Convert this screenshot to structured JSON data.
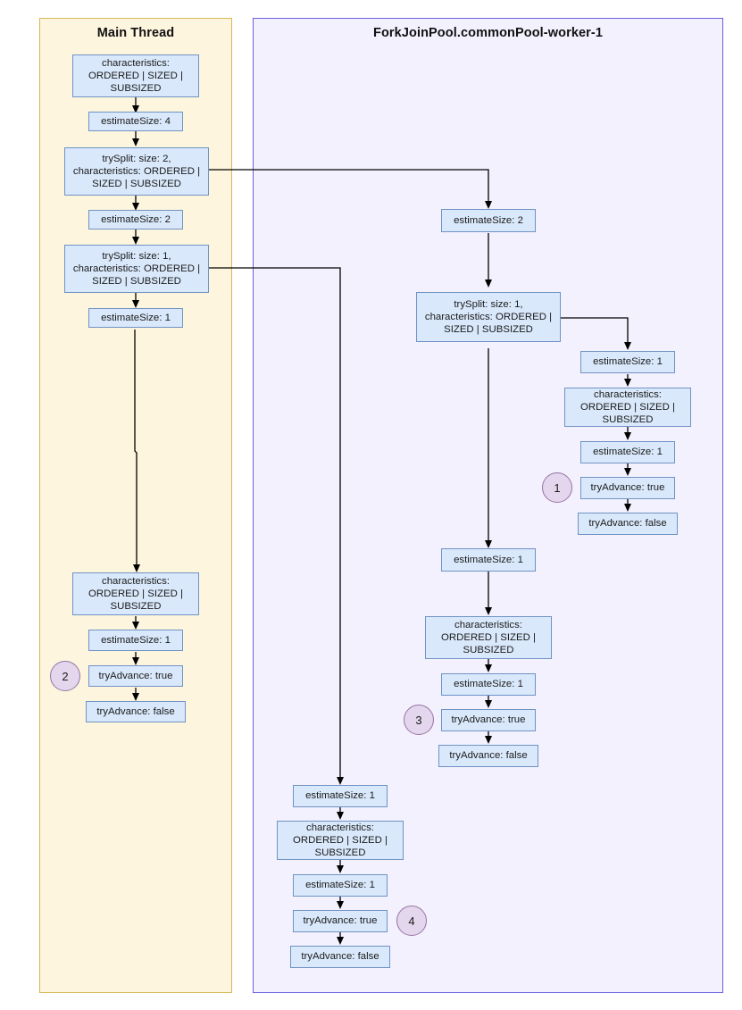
{
  "diagram": {
    "title_main_thread": "Main Thread",
    "title_worker": "ForkJoinPool.commonPool-worker-1",
    "colors": {
      "node_fill": "#d9e8fb",
      "node_stroke": "#7093c4",
      "lane_main_fill": "#fdf5de",
      "lane_main_stroke": "#d6b656",
      "lane_worker_fill": "#f3f1fd",
      "lane_worker_stroke": "#6b5fe0",
      "badge_fill": "#e4d6ec",
      "badge_stroke": "#9673a6",
      "edge_stroke": "#000000"
    }
  },
  "main_thread": {
    "lane_label": "Main Thread",
    "nodes": [
      {
        "id": "m1",
        "label": "characteristics:\nORDERED | SIZED |\nSUBSIZED"
      },
      {
        "id": "m2",
        "label": "estimateSize: 4"
      },
      {
        "id": "m3",
        "label": "trySplit: size: 2,\ncharacteristics: ORDERED |\nSIZED | SUBSIZED"
      },
      {
        "id": "m4",
        "label": "estimateSize: 2"
      },
      {
        "id": "m5",
        "label": "trySplit: size: 1,\ncharacteristics: ORDERED |\nSIZED | SUBSIZED"
      },
      {
        "id": "m6",
        "label": "estimateSize: 1"
      },
      {
        "id": "m7",
        "label": "characteristics:\nORDERED | SIZED |\nSUBSIZED"
      },
      {
        "id": "m8",
        "label": "estimateSize: 1"
      },
      {
        "id": "m9",
        "label": "tryAdvance: true"
      },
      {
        "id": "m10",
        "label": "tryAdvance: false"
      }
    ],
    "badge": "2"
  },
  "worker": {
    "lane_label": "ForkJoinPool.commonPool-worker-1",
    "branch_top": {
      "nodes": [
        {
          "id": "w1",
          "label": "estimateSize: 2"
        },
        {
          "id": "w2",
          "label": "trySplit: size: 1,\ncharacteristics: ORDERED |\nSIZED | SUBSIZED"
        }
      ]
    },
    "branch_right": {
      "nodes": [
        {
          "id": "r1",
          "label": "estimateSize: 1"
        },
        {
          "id": "r2",
          "label": "characteristics:\nORDERED | SIZED |\nSUBSIZED"
        },
        {
          "id": "r3",
          "label": "estimateSize: 1"
        },
        {
          "id": "r4",
          "label": "tryAdvance: true"
        },
        {
          "id": "r5",
          "label": "tryAdvance: false"
        }
      ],
      "badge": "1"
    },
    "branch_middle": {
      "nodes": [
        {
          "id": "c1",
          "label": "estimateSize: 1"
        },
        {
          "id": "c2",
          "label": "characteristics:\nORDERED | SIZED |\nSUBSIZED"
        },
        {
          "id": "c3",
          "label": "estimateSize: 1"
        },
        {
          "id": "c4",
          "label": "tryAdvance: true"
        },
        {
          "id": "c5",
          "label": "tryAdvance: false"
        }
      ],
      "badge": "3"
    },
    "branch_left": {
      "nodes": [
        {
          "id": "l1",
          "label": "estimateSize: 1"
        },
        {
          "id": "l2",
          "label": "characteristics:\nORDERED | SIZED |\nSUBSIZED"
        },
        {
          "id": "l3",
          "label": "estimateSize: 1"
        },
        {
          "id": "l4",
          "label": "tryAdvance: true"
        },
        {
          "id": "l5",
          "label": "tryAdvance: false"
        }
      ],
      "badge": "4"
    }
  }
}
